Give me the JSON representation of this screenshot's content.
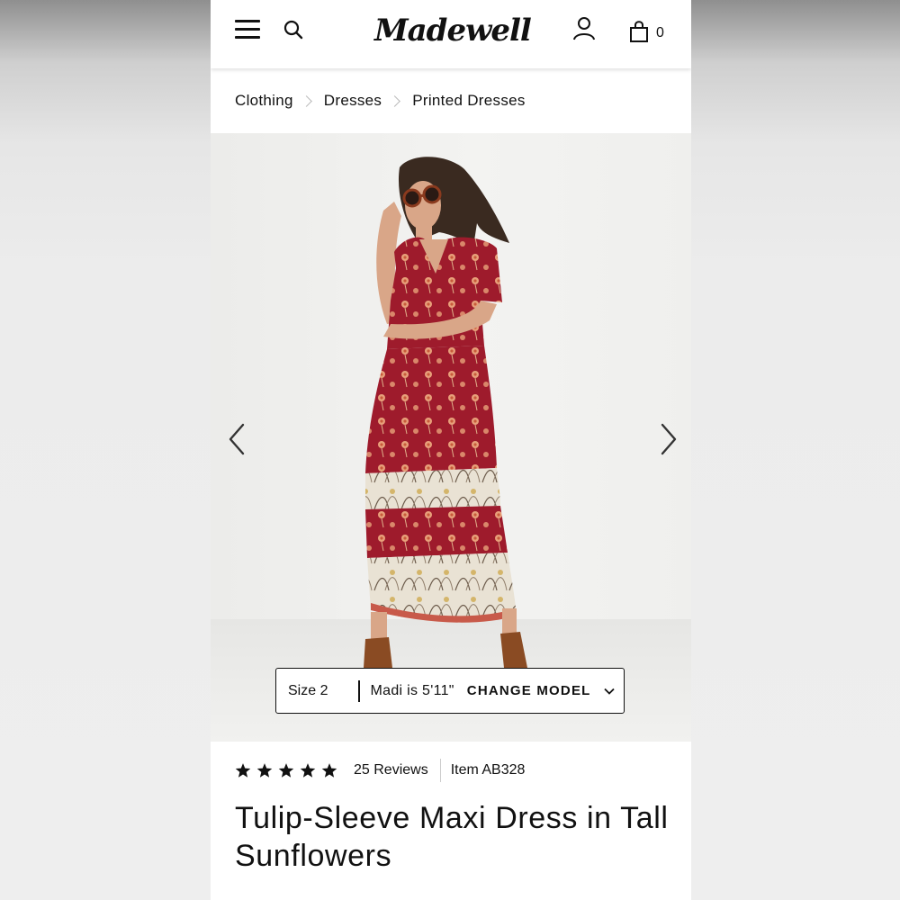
{
  "header": {
    "logo_text": "Madewell",
    "bag_count": "0",
    "icons": [
      "menu-icon",
      "search-icon",
      "account-icon",
      "shopping-bag-icon"
    ]
  },
  "breadcrumb": [
    {
      "label": "Clothing"
    },
    {
      "label": "Dresses"
    },
    {
      "label": "Printed Dresses"
    }
  ],
  "gallery": {
    "size_label": "Size 2",
    "model_height": "Madi is 5'11\"",
    "change_model_label": "CHANGE MODEL"
  },
  "product": {
    "rating": 5,
    "max_rating": 5,
    "reviews": "25 Reviews",
    "item_number": "Item AB328",
    "title": "Tulip-Sleeve Maxi Dress in Tall Sunflowers"
  },
  "colors": {
    "dress": "#9e1b2c",
    "floral": "#e8a07a",
    "boots": "#8a4b23",
    "text": "#111111"
  }
}
